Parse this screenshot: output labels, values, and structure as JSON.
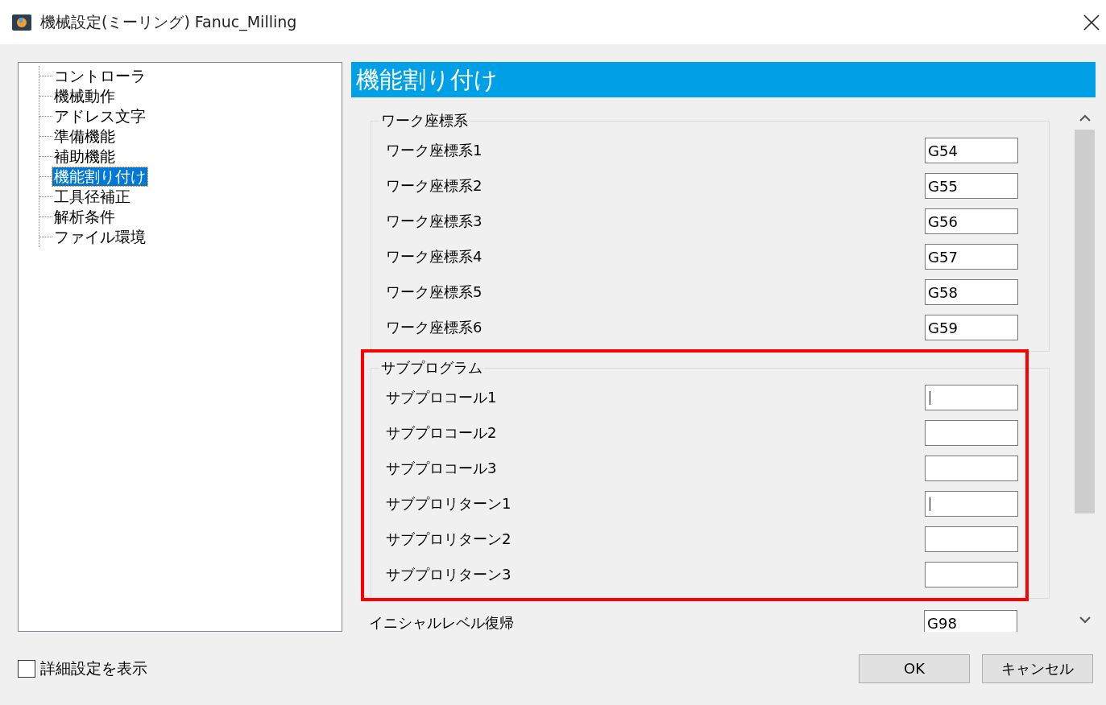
{
  "window": {
    "title": "機械設定(ミーリング) Fanuc_Milling"
  },
  "tree": {
    "items": [
      {
        "label": "コントローラ",
        "selected": false
      },
      {
        "label": "機械動作",
        "selected": false
      },
      {
        "label": "アドレス文字",
        "selected": false
      },
      {
        "label": "準備機能",
        "selected": false
      },
      {
        "label": "補助機能",
        "selected": false
      },
      {
        "label": "機能割り付け",
        "selected": true
      },
      {
        "label": "工具径補正",
        "selected": false
      },
      {
        "label": "解析条件",
        "selected": false
      },
      {
        "label": "ファイル環境",
        "selected": false
      }
    ]
  },
  "panel": {
    "title": "機能割り付け",
    "groups": [
      {
        "title": "ワーク座標系",
        "highlighted": false,
        "fields": [
          {
            "label": "ワーク座標系1",
            "value": "G54",
            "caret": false
          },
          {
            "label": "ワーク座標系2",
            "value": "G55",
            "caret": false
          },
          {
            "label": "ワーク座標系3",
            "value": "G56",
            "caret": false
          },
          {
            "label": "ワーク座標系4",
            "value": "G57",
            "caret": false
          },
          {
            "label": "ワーク座標系5",
            "value": "G58",
            "caret": false
          },
          {
            "label": "ワーク座標系6",
            "value": "G59",
            "caret": false
          }
        ]
      },
      {
        "title": "サブプログラム",
        "highlighted": true,
        "fields": [
          {
            "label": "サブプロコール1",
            "caret": true
          },
          {
            "label": "サブプロコール2",
            "caret": false
          },
          {
            "label": "サブプロコール3",
            "caret": false
          },
          {
            "label": "サブプロリターン1",
            "caret": true
          },
          {
            "label": "サブプロリターン2",
            "caret": false
          },
          {
            "label": "サブプロリターン3",
            "caret": false
          }
        ]
      }
    ],
    "fields": [
      {
        "label": "イニシャルレベル復帰",
        "value": "G98",
        "caret": false
      }
    ]
  },
  "footer": {
    "checkbox": {
      "label": "詳細設定を表示",
      "checked": false
    },
    "buttons": [
      "OK",
      "キャンセル"
    ]
  }
}
